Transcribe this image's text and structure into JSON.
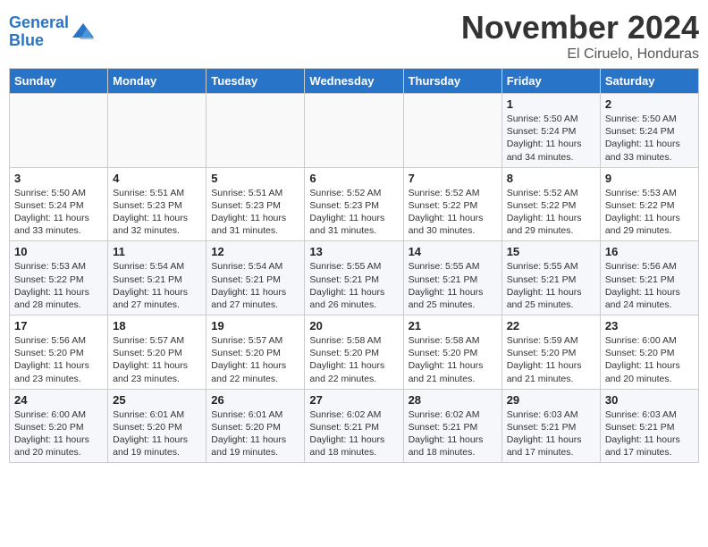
{
  "header": {
    "logo_line1": "General",
    "logo_line2": "Blue",
    "month": "November 2024",
    "location": "El Ciruelo, Honduras"
  },
  "weekdays": [
    "Sunday",
    "Monday",
    "Tuesday",
    "Wednesday",
    "Thursday",
    "Friday",
    "Saturday"
  ],
  "weeks": [
    [
      {
        "day": "",
        "info": ""
      },
      {
        "day": "",
        "info": ""
      },
      {
        "day": "",
        "info": ""
      },
      {
        "day": "",
        "info": ""
      },
      {
        "day": "",
        "info": ""
      },
      {
        "day": "1",
        "info": "Sunrise: 5:50 AM\nSunset: 5:24 PM\nDaylight: 11 hours\nand 34 minutes."
      },
      {
        "day": "2",
        "info": "Sunrise: 5:50 AM\nSunset: 5:24 PM\nDaylight: 11 hours\nand 33 minutes."
      }
    ],
    [
      {
        "day": "3",
        "info": "Sunrise: 5:50 AM\nSunset: 5:24 PM\nDaylight: 11 hours\nand 33 minutes."
      },
      {
        "day": "4",
        "info": "Sunrise: 5:51 AM\nSunset: 5:23 PM\nDaylight: 11 hours\nand 32 minutes."
      },
      {
        "day": "5",
        "info": "Sunrise: 5:51 AM\nSunset: 5:23 PM\nDaylight: 11 hours\nand 31 minutes."
      },
      {
        "day": "6",
        "info": "Sunrise: 5:52 AM\nSunset: 5:23 PM\nDaylight: 11 hours\nand 31 minutes."
      },
      {
        "day": "7",
        "info": "Sunrise: 5:52 AM\nSunset: 5:22 PM\nDaylight: 11 hours\nand 30 minutes."
      },
      {
        "day": "8",
        "info": "Sunrise: 5:52 AM\nSunset: 5:22 PM\nDaylight: 11 hours\nand 29 minutes."
      },
      {
        "day": "9",
        "info": "Sunrise: 5:53 AM\nSunset: 5:22 PM\nDaylight: 11 hours\nand 29 minutes."
      }
    ],
    [
      {
        "day": "10",
        "info": "Sunrise: 5:53 AM\nSunset: 5:22 PM\nDaylight: 11 hours\nand 28 minutes."
      },
      {
        "day": "11",
        "info": "Sunrise: 5:54 AM\nSunset: 5:21 PM\nDaylight: 11 hours\nand 27 minutes."
      },
      {
        "day": "12",
        "info": "Sunrise: 5:54 AM\nSunset: 5:21 PM\nDaylight: 11 hours\nand 27 minutes."
      },
      {
        "day": "13",
        "info": "Sunrise: 5:55 AM\nSunset: 5:21 PM\nDaylight: 11 hours\nand 26 minutes."
      },
      {
        "day": "14",
        "info": "Sunrise: 5:55 AM\nSunset: 5:21 PM\nDaylight: 11 hours\nand 25 minutes."
      },
      {
        "day": "15",
        "info": "Sunrise: 5:55 AM\nSunset: 5:21 PM\nDaylight: 11 hours\nand 25 minutes."
      },
      {
        "day": "16",
        "info": "Sunrise: 5:56 AM\nSunset: 5:21 PM\nDaylight: 11 hours\nand 24 minutes."
      }
    ],
    [
      {
        "day": "17",
        "info": "Sunrise: 5:56 AM\nSunset: 5:20 PM\nDaylight: 11 hours\nand 23 minutes."
      },
      {
        "day": "18",
        "info": "Sunrise: 5:57 AM\nSunset: 5:20 PM\nDaylight: 11 hours\nand 23 minutes."
      },
      {
        "day": "19",
        "info": "Sunrise: 5:57 AM\nSunset: 5:20 PM\nDaylight: 11 hours\nand 22 minutes."
      },
      {
        "day": "20",
        "info": "Sunrise: 5:58 AM\nSunset: 5:20 PM\nDaylight: 11 hours\nand 22 minutes."
      },
      {
        "day": "21",
        "info": "Sunrise: 5:58 AM\nSunset: 5:20 PM\nDaylight: 11 hours\nand 21 minutes."
      },
      {
        "day": "22",
        "info": "Sunrise: 5:59 AM\nSunset: 5:20 PM\nDaylight: 11 hours\nand 21 minutes."
      },
      {
        "day": "23",
        "info": "Sunrise: 6:00 AM\nSunset: 5:20 PM\nDaylight: 11 hours\nand 20 minutes."
      }
    ],
    [
      {
        "day": "24",
        "info": "Sunrise: 6:00 AM\nSunset: 5:20 PM\nDaylight: 11 hours\nand 20 minutes."
      },
      {
        "day": "25",
        "info": "Sunrise: 6:01 AM\nSunset: 5:20 PM\nDaylight: 11 hours\nand 19 minutes."
      },
      {
        "day": "26",
        "info": "Sunrise: 6:01 AM\nSunset: 5:20 PM\nDaylight: 11 hours\nand 19 minutes."
      },
      {
        "day": "27",
        "info": "Sunrise: 6:02 AM\nSunset: 5:21 PM\nDaylight: 11 hours\nand 18 minutes."
      },
      {
        "day": "28",
        "info": "Sunrise: 6:02 AM\nSunset: 5:21 PM\nDaylight: 11 hours\nand 18 minutes."
      },
      {
        "day": "29",
        "info": "Sunrise: 6:03 AM\nSunset: 5:21 PM\nDaylight: 11 hours\nand 17 minutes."
      },
      {
        "day": "30",
        "info": "Sunrise: 6:03 AM\nSunset: 5:21 PM\nDaylight: 11 hours\nand 17 minutes."
      }
    ]
  ]
}
